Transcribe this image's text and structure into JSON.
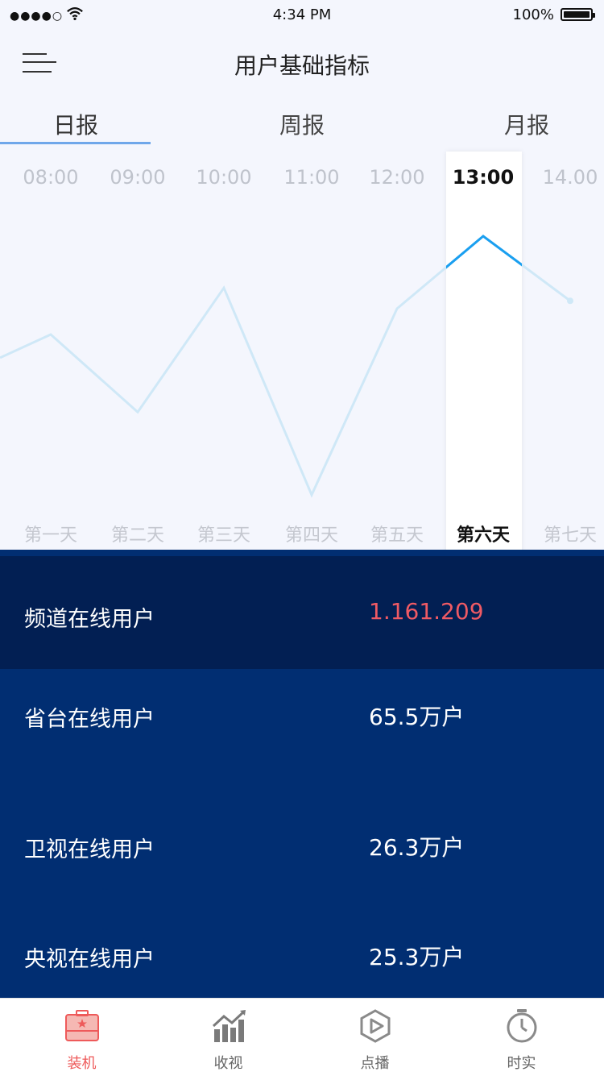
{
  "status_bar": {
    "signal": "●●●●○",
    "time": "4:34 PM",
    "battery": "100%"
  },
  "nav": {
    "title": "用户基础指标"
  },
  "tabs": [
    {
      "label": "日报",
      "active": true
    },
    {
      "label": "周报",
      "active": false
    },
    {
      "label": "月报",
      "active": false
    }
  ],
  "chart_data": {
    "type": "line",
    "x_top_labels": [
      "08:00",
      "09:00",
      "10:00",
      "11:00",
      "12:00",
      "13:00",
      "14.00"
    ],
    "x_bottom_labels": [
      "第一天",
      "第二天",
      "第三天",
      "第四天",
      "第五天",
      "第六天",
      "第七天"
    ],
    "selected_index": 5,
    "relative_values": [
      0.62,
      0.32,
      0.8,
      0.0,
      0.72,
      1.0,
      0.75
    ],
    "colors": {
      "line": "#cfe8f7",
      "line_active": "#1a9ff0"
    }
  },
  "stats": [
    {
      "label": "频道在线用户",
      "value": "1.161.209",
      "highlight": true
    },
    {
      "label": "省台在线用户",
      "value": "65.5万户"
    },
    {
      "label": "卫视在线用户",
      "value": "26.3万户"
    },
    {
      "label": "央视在线用户",
      "value": "25.3万户"
    }
  ],
  "tabbar": [
    {
      "label": "装机",
      "icon": "toolbox-icon",
      "active": true
    },
    {
      "label": "收视",
      "icon": "chart-bars-icon",
      "active": false
    },
    {
      "label": "点播",
      "icon": "play-hexagon-icon",
      "active": false
    },
    {
      "label": "时实",
      "icon": "stopwatch-icon",
      "active": false
    }
  ]
}
